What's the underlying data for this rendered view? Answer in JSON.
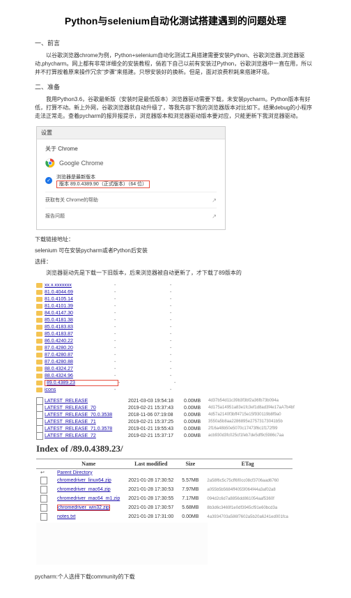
{
  "title": "Python与selenium自动化测试搭建遇到的问题处理",
  "s1": {
    "heading": "一、前言",
    "p1": "以谷歌浏览器chrome为例，Python+selenium自动化测试工具搭建需要安装Python、谷歌浏览器,浏览器驱动,phycharm。网上都有非常详细全的安装教程，倘若下自己以前有安装过Python，谷歌浏览器中一直在用，所以并不打算按着原来操作冗余\"步骤\"来搭建。只想安装好的换新。但是，面对浪费积耗来搭建环境。"
  },
  "s2": {
    "heading": "二、准备",
    "p1": "我用Python3.6，谷歌最新版（安装时是最低版本）浏览器驱动需要下载，未安装pycharm。Python版本有好低，打算不动。新上外网，谷歌浏览器就自动升级了，等我先容下我的浏览器版本对比如下。结果debug的小程序走法正常走。查着pycharm的报异报提示，浏览器版本和浏览器驱动版本要对应，只能更新下我浏览器驱动。",
    "chrome": {
      "tab": "设置",
      "about": "关于 Chrome",
      "name": "Google Chrome",
      "status": "浏览器是最新版本",
      "version": "版本 89.0.4389.90（正式版本）（64 位）",
      "help": "获取有关 Chrome的帮助",
      "report": "报告问题"
    }
  },
  "s3": {
    "p1": "下载链接地址：",
    "p2": "selenium 可在安装pycharm或者Python后安装",
    "p3": "选择：",
    "p4": "浏览器驱动先是下载一下旧版本，后来浏览器被自动更新了，才下载了89版本的",
    "drivers": [
      {
        "v": "xx.x.xxxxxxx"
      },
      {
        "v": "81.0.4044.69"
      },
      {
        "v": "81.0.4105.14"
      },
      {
        "v": "81.0.4101.39"
      },
      {
        "v": "84.0.4147.30"
      },
      {
        "v": "85.0.4181.38"
      },
      {
        "v": "85.0.4183.83"
      },
      {
        "v": "85.0.4183.87"
      },
      {
        "v": "86.0.4240.22"
      },
      {
        "v": "87.0.4280.20"
      },
      {
        "v": "87.0.4280.87"
      },
      {
        "v": "87.0.4280.88"
      },
      {
        "v": "88.0.4324.27"
      },
      {
        "v": "88.0.4324.96"
      },
      {
        "v": "89.0.4389.23",
        "boxed": true
      },
      {
        "v": "icons"
      }
    ],
    "releases": [
      {
        "name": "LATEST_RELEASE",
        "date": "2021-03-03 19:54:18",
        "size": "0.00MB",
        "hash": "4d37b54d11c39b3f3bf2a36fb73b094a"
      },
      {
        "name": "LATEST_RELEASE_70",
        "date": "2019-02-21 15:37:43",
        "size": "0.00MB",
        "hash": "4d175a14951a83e1fc3ef1d8ad3f4e17aA7b4bf"
      },
      {
        "name": "LATEST_RELEASE_70.0.3538",
        "date": "2018-11-06 07:19:08",
        "size": "0.00MB",
        "hash": "4d57a2140f3bff4715e15f930119b8f9a0"
      },
      {
        "name": "LATEST_RELEASE_71",
        "date": "2019-02-21 15:37:25",
        "size": "0.00MB",
        "hash": "3550a5b8aa2286895e27573173041b5b"
      },
      {
        "name": "LATEST_RELEASE_71.0.3578",
        "date": "2019-01-21 19:55:43",
        "size": "0.00MB",
        "hash": "2f16a48b50e5070c17473f6c1f172f99"
      },
      {
        "name": "LATEST_RELEASE_72",
        "date": "2019-02-21 15:37:17",
        "size": "0.00MB",
        "hash": "acb930d3fc025cf1feb7de5df9c5986c7aa"
      }
    ]
  },
  "index": {
    "title": "Index of /89.0.4389.23/",
    "headers": {
      "name": "Name",
      "lm": "Last modified",
      "size": "Size",
      "etag": "ETag"
    },
    "rows": [
      {
        "icon": "back",
        "name": "Parent Directory",
        "date": "",
        "size": "",
        "etag": ""
      },
      {
        "icon": "file",
        "name": "chromedriver_linux64.zip",
        "date": "2021-01-28 17:30:52",
        "size": "5.57MB",
        "etag": "2a58f6c5c75cff6f0cc08cf3706aad6760"
      },
      {
        "icon": "file",
        "name": "chromedriver_mac64.zip",
        "date": "2021-01-28 17:30:53",
        "size": "7.97MB",
        "etag": "a055b5b5684ff4055f064f44a3af02a8"
      },
      {
        "icon": "file",
        "name": "chromedriver_mac64_m1.zip",
        "date": "2021-01-28 17:30:55",
        "size": "7.17MB",
        "etag": "094d2c6d7a8856dd861054aaf5360f"
      },
      {
        "icon": "file",
        "name": "chromedriver_win32.zip",
        "date": "2021-01-28 17:30:57",
        "size": "5.68MB",
        "etag": "8b3d6c3469f1e0df3945cf91e60bcd3a",
        "boxed": true
      },
      {
        "icon": "file",
        "name": "notes.txt",
        "date": "2021-01-28 17:31:00",
        "size": "0.00MB",
        "etag": "4a3934703a586f7602a5b20a6241ed001fca"
      }
    ]
  },
  "footer": "pycharm:个人选择下载community的下载"
}
